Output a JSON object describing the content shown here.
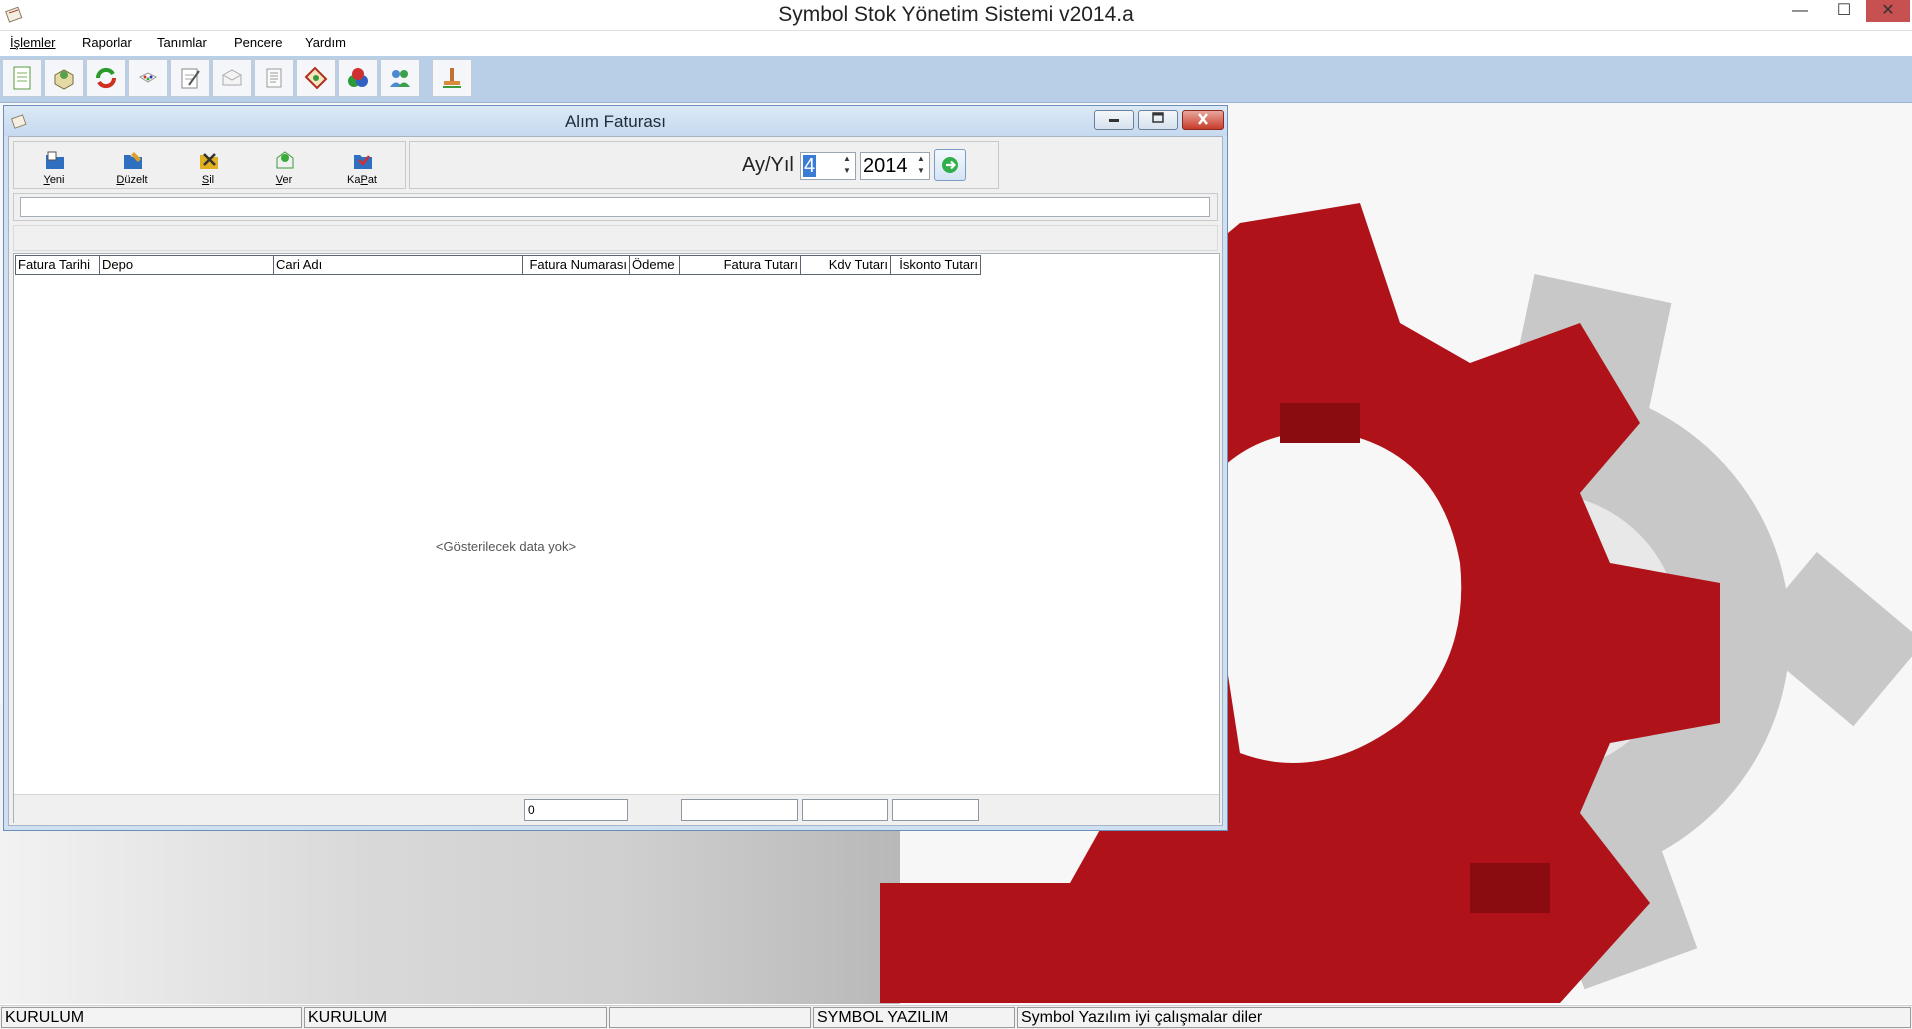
{
  "window": {
    "title": "Symbol Stok Yönetim Sistemi v2014.a",
    "min_glyph": "—",
    "max_glyph": "☐",
    "close_glyph": "✕"
  },
  "menu": [
    {
      "label": "İşlemler"
    },
    {
      "label": "Raporlar"
    },
    {
      "label": "Tanımlar"
    },
    {
      "label": "Pencere"
    },
    {
      "label": "Yardım"
    }
  ],
  "toolbar": {
    "buttons": [
      {
        "icon": "new-document-icon"
      },
      {
        "icon": "package-icon"
      },
      {
        "icon": "refresh-icon"
      },
      {
        "icon": "dice-icon"
      },
      {
        "icon": "edit-note-icon"
      },
      {
        "icon": "envelope-icon"
      },
      {
        "icon": "list-document-icon"
      },
      {
        "icon": "tag-icon"
      },
      {
        "icon": "color-circles-icon"
      },
      {
        "icon": "users-icon"
      },
      {
        "icon": "stamp-icon"
      }
    ]
  },
  "child_window": {
    "title": "Alım Faturası",
    "actions": [
      {
        "key": "Y",
        "rest": "eni"
      },
      {
        "key": "D",
        "rest": "üzelt"
      },
      {
        "key": "S",
        "rest": "il"
      },
      {
        "key": "V",
        "rest": "er"
      },
      {
        "pre": "Ka",
        "key": "P",
        "rest": "at"
      }
    ],
    "filter": {
      "label": "Ay/Yıl",
      "month": "4",
      "year": "2014"
    },
    "search": {
      "value": ""
    },
    "grid": {
      "columns": [
        "Fatura Tarihi",
        "Depo",
        "Cari Adı",
        "Fatura Numarası",
        "Ödeme",
        "Fatura Tutarı",
        "Kdv Tutarı",
        "İskonto Tutarı"
      ],
      "empty_text": "<Gösterilecek data yok>",
      "footer": {
        "count": "0",
        "fatura_tutari": "",
        "kdv_tutari": "",
        "iskonto_tutari": ""
      }
    }
  },
  "statusbar": [
    "KURULUM",
    "KURULUM",
    "",
    "SYMBOL YAZILIM",
    "Symbol Yazılım iyi çalışmalar diler"
  ],
  "colors": {
    "toolbar_bg": "#b9cfe8",
    "gear_red": "#b0121a",
    "gear_gray": "#c8c8c8"
  }
}
